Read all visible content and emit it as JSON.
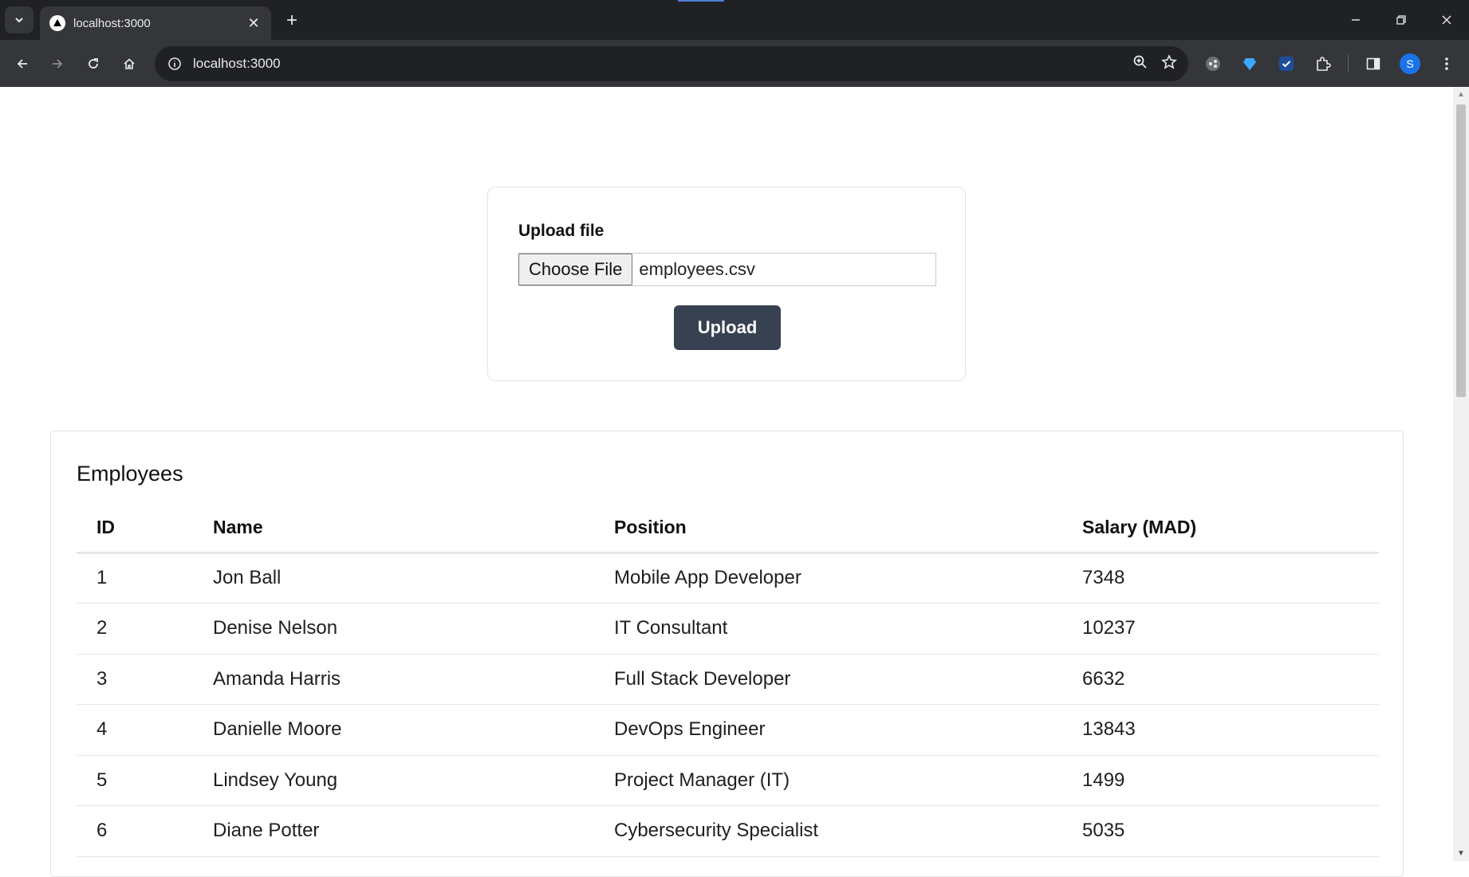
{
  "browser": {
    "tab_title": "localhost:3000",
    "url": "localhost:3000",
    "profile_initial": "S"
  },
  "upload": {
    "label": "Upload file",
    "choose_button": "Choose File",
    "file_name": "employees.csv",
    "upload_button": "Upload"
  },
  "employees": {
    "title": "Employees",
    "columns": [
      "ID",
      "Name",
      "Position",
      "Salary (MAD)"
    ],
    "rows": [
      {
        "id": "1",
        "name": "Jon Ball",
        "position": "Mobile App Developer",
        "salary": "7348"
      },
      {
        "id": "2",
        "name": "Denise Nelson",
        "position": "IT Consultant",
        "salary": "10237"
      },
      {
        "id": "3",
        "name": "Amanda Harris",
        "position": "Full Stack Developer",
        "salary": "6632"
      },
      {
        "id": "4",
        "name": "Danielle Moore",
        "position": "DevOps Engineer",
        "salary": "13843"
      },
      {
        "id": "5",
        "name": "Lindsey Young",
        "position": "Project Manager (IT)",
        "salary": "1499"
      },
      {
        "id": "6",
        "name": "Diane Potter",
        "position": "Cybersecurity Specialist",
        "salary": "5035"
      }
    ]
  },
  "colors": {
    "upload_button_bg": "#374151",
    "chrome_dark": "#202124",
    "chrome_toolbar": "#35363a"
  }
}
